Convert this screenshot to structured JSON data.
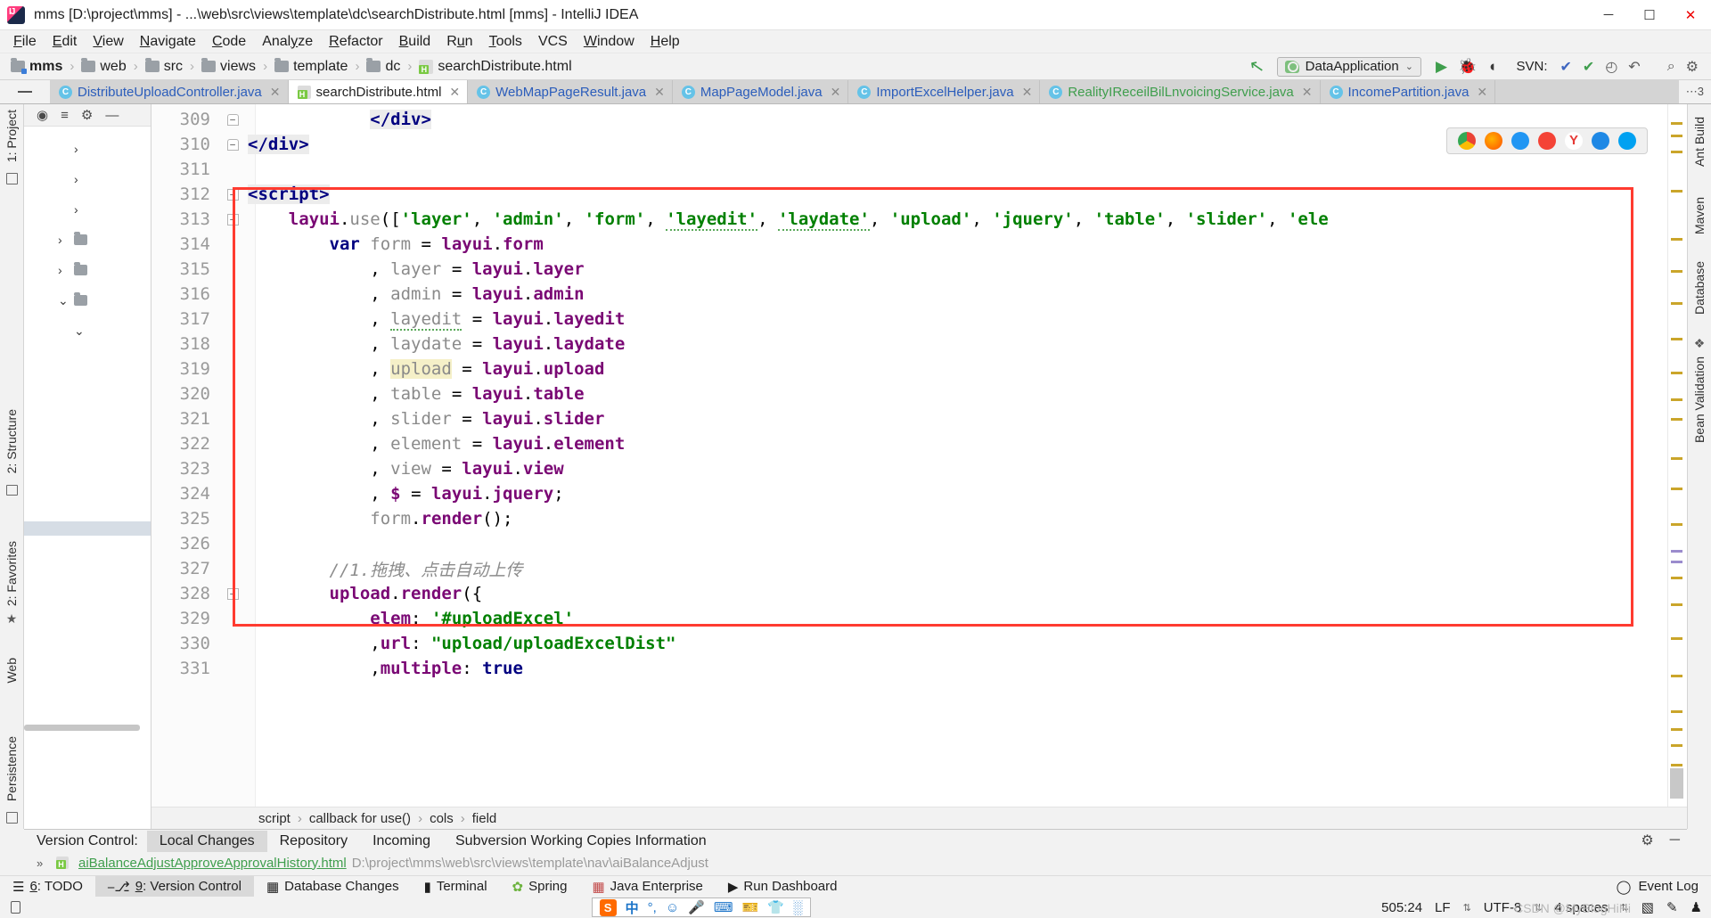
{
  "window": {
    "title": "mms [D:\\project\\mms] - ...\\web\\src\\views\\template\\dc\\searchDistribute.html [mms] - IntelliJ IDEA",
    "minimize": "─",
    "maximize": "☐",
    "close": "✕"
  },
  "menubar": [
    {
      "label": "File"
    },
    {
      "label": "Edit"
    },
    {
      "label": "View"
    },
    {
      "label": "Navigate"
    },
    {
      "label": "Code"
    },
    {
      "label": "Analyze"
    },
    {
      "label": "Refactor"
    },
    {
      "label": "Build"
    },
    {
      "label": "Run"
    },
    {
      "label": "Tools"
    },
    {
      "label": "VCS"
    },
    {
      "label": "Window"
    },
    {
      "label": "Help"
    }
  ],
  "breadcrumb": {
    "items": [
      "mms",
      "web",
      "src",
      "views",
      "template",
      "dc"
    ],
    "file": "searchDistribute.html",
    "separator": "›"
  },
  "run_toolbar": {
    "back_arrow": "↖",
    "config_name": "DataApplication",
    "dropdown_caret": "⌄",
    "run_icon": "▶",
    "debug_icon": "🐞",
    "coverage_icon": "◖",
    "svn_label": "SVN:",
    "svn_update": "✔",
    "svn_commit": "✔",
    "history_icon": "◴",
    "rollback_icon": "↶",
    "search_icon": "⌕",
    "settings_icon": "⚙"
  },
  "tabs": [
    {
      "label": "DistributeUploadController.java",
      "icon": "class-icon",
      "active": false,
      "color": "blue"
    },
    {
      "label": "searchDistribute.html",
      "icon": "html-icon",
      "active": true,
      "color": "black"
    },
    {
      "label": "WebMapPageResult.java",
      "icon": "class-icon",
      "active": false,
      "color": "blue"
    },
    {
      "label": "MapPageModel.java",
      "icon": "class-icon",
      "active": false,
      "color": "blue"
    },
    {
      "label": "ImportExcelHelper.java",
      "icon": "class-icon",
      "active": false,
      "color": "blue"
    },
    {
      "label": "RealityIReceilBilLnvoicingService.java",
      "icon": "class-icon",
      "active": false,
      "color": "green"
    },
    {
      "label": "IncomePartition.java",
      "icon": "class-icon",
      "active": false,
      "color": "blue"
    }
  ],
  "tab_overflow": "⋯3",
  "tab_close_glyph": "✕",
  "left_toolwindows": [
    {
      "label": "1: Project",
      "selected": false
    },
    {
      "label": "2: Structure",
      "selected": false
    },
    {
      "label": "2: Favorites",
      "selected": false
    },
    {
      "label": "Web",
      "selected": false
    },
    {
      "label": "Persistence",
      "selected": false
    }
  ],
  "right_toolwindows": [
    {
      "label": "Ant Build"
    },
    {
      "label": "Maven"
    },
    {
      "label": "Database"
    },
    {
      "label": "Bean Validation"
    }
  ],
  "editor": {
    "lines": [
      {
        "n": "309",
        "fold": "house",
        "indent": 6,
        "tokens": [
          {
            "t": "</div>",
            "c": "tag hl"
          }
        ]
      },
      {
        "n": "310",
        "fold": "house",
        "indent": 0,
        "tokens": [
          {
            "t": "</div>",
            "c": "tag hl"
          }
        ]
      },
      {
        "n": "311",
        "fold": "",
        "indent": 0,
        "tokens": []
      },
      {
        "n": "312",
        "fold": "down",
        "indent": 0,
        "tokens": [
          {
            "t": "<script>",
            "c": "tag hl"
          }
        ]
      },
      {
        "n": "313",
        "fold": "down",
        "indent": 2,
        "tokens": [
          {
            "t": "layui",
            "c": "fn"
          },
          {
            "t": ".",
            "c": "plain"
          },
          {
            "t": "use",
            "c": "ident"
          },
          {
            "t": "([",
            "c": "plain"
          },
          {
            "t": "'layer'",
            "c": "str"
          },
          {
            "t": ", ",
            "c": "plain"
          },
          {
            "t": "'admin'",
            "c": "str"
          },
          {
            "t": ", ",
            "c": "plain"
          },
          {
            "t": "'form'",
            "c": "str"
          },
          {
            "t": ", ",
            "c": "plain"
          },
          {
            "t": "'layedit'",
            "c": "str wavy"
          },
          {
            "t": ", ",
            "c": "plain"
          },
          {
            "t": "'laydate'",
            "c": "str wavy"
          },
          {
            "t": ", ",
            "c": "plain"
          },
          {
            "t": "'upload'",
            "c": "str"
          },
          {
            "t": ", ",
            "c": "plain"
          },
          {
            "t": "'jquery'",
            "c": "str"
          },
          {
            "t": ", ",
            "c": "plain"
          },
          {
            "t": "'table'",
            "c": "str"
          },
          {
            "t": ", ",
            "c": "plain"
          },
          {
            "t": "'slider'",
            "c": "str"
          },
          {
            "t": ", ",
            "c": "plain"
          },
          {
            "t": "'ele",
            "c": "str"
          }
        ]
      },
      {
        "n": "314",
        "fold": "",
        "indent": 4,
        "tokens": [
          {
            "t": "var",
            "c": "kw"
          },
          {
            "t": " ",
            "c": "plain"
          },
          {
            "t": "form",
            "c": "ident"
          },
          {
            "t": " = ",
            "c": "plain"
          },
          {
            "t": "layui",
            "c": "fn"
          },
          {
            "t": ".",
            "c": "plain"
          },
          {
            "t": "form",
            "c": "fn"
          }
        ]
      },
      {
        "n": "315",
        "fold": "",
        "indent": 6,
        "tokens": [
          {
            "t": ", ",
            "c": "plain"
          },
          {
            "t": "layer",
            "c": "ident"
          },
          {
            "t": " = ",
            "c": "plain"
          },
          {
            "t": "layui",
            "c": "fn"
          },
          {
            "t": ".",
            "c": "plain"
          },
          {
            "t": "layer",
            "c": "fn"
          }
        ]
      },
      {
        "n": "316",
        "fold": "",
        "indent": 6,
        "tokens": [
          {
            "t": ", ",
            "c": "plain"
          },
          {
            "t": "admin",
            "c": "ident"
          },
          {
            "t": " = ",
            "c": "plain"
          },
          {
            "t": "layui",
            "c": "fn"
          },
          {
            "t": ".",
            "c": "plain"
          },
          {
            "t": "admin",
            "c": "fn"
          }
        ]
      },
      {
        "n": "317",
        "fold": "",
        "indent": 6,
        "tokens": [
          {
            "t": ", ",
            "c": "plain"
          },
          {
            "t": "layedit",
            "c": "ident wavy"
          },
          {
            "t": " = ",
            "c": "plain"
          },
          {
            "t": "layui",
            "c": "fn"
          },
          {
            "t": ".",
            "c": "plain"
          },
          {
            "t": "layedit",
            "c": "fn"
          }
        ]
      },
      {
        "n": "318",
        "fold": "",
        "indent": 6,
        "tokens": [
          {
            "t": ", ",
            "c": "plain"
          },
          {
            "t": "laydate",
            "c": "ident"
          },
          {
            "t": " = ",
            "c": "plain"
          },
          {
            "t": "layui",
            "c": "fn"
          },
          {
            "t": ".",
            "c": "plain"
          },
          {
            "t": "laydate",
            "c": "fn"
          }
        ]
      },
      {
        "n": "319",
        "fold": "",
        "indent": 6,
        "tokens": [
          {
            "t": ", ",
            "c": "plain"
          },
          {
            "t": "upload",
            "c": "ident hlsoft"
          },
          {
            "t": " = ",
            "c": "plain"
          },
          {
            "t": "layui",
            "c": "fn"
          },
          {
            "t": ".",
            "c": "plain"
          },
          {
            "t": "upload",
            "c": "fn"
          }
        ]
      },
      {
        "n": "320",
        "fold": "",
        "indent": 6,
        "tokens": [
          {
            "t": ", ",
            "c": "plain"
          },
          {
            "t": "table",
            "c": "ident"
          },
          {
            "t": " = ",
            "c": "plain"
          },
          {
            "t": "layui",
            "c": "fn"
          },
          {
            "t": ".",
            "c": "plain"
          },
          {
            "t": "table",
            "c": "fn"
          }
        ]
      },
      {
        "n": "321",
        "fold": "",
        "indent": 6,
        "tokens": [
          {
            "t": ", ",
            "c": "plain"
          },
          {
            "t": "slider",
            "c": "ident"
          },
          {
            "t": " = ",
            "c": "plain"
          },
          {
            "t": "layui",
            "c": "fn"
          },
          {
            "t": ".",
            "c": "plain"
          },
          {
            "t": "slider",
            "c": "fn"
          }
        ]
      },
      {
        "n": "322",
        "fold": "",
        "indent": 6,
        "tokens": [
          {
            "t": ", ",
            "c": "plain"
          },
          {
            "t": "element",
            "c": "ident"
          },
          {
            "t": " = ",
            "c": "plain"
          },
          {
            "t": "layui",
            "c": "fn"
          },
          {
            "t": ".",
            "c": "plain"
          },
          {
            "t": "element",
            "c": "fn"
          }
        ]
      },
      {
        "n": "323",
        "fold": "",
        "indent": 6,
        "tokens": [
          {
            "t": ", ",
            "c": "plain"
          },
          {
            "t": "view",
            "c": "ident"
          },
          {
            "t": " = ",
            "c": "plain"
          },
          {
            "t": "layui",
            "c": "fn"
          },
          {
            "t": ".",
            "c": "plain"
          },
          {
            "t": "view",
            "c": "fn"
          }
        ]
      },
      {
        "n": "324",
        "fold": "",
        "indent": 6,
        "tokens": [
          {
            "t": ", ",
            "c": "plain"
          },
          {
            "t": "$",
            "c": "fn"
          },
          {
            "t": " = ",
            "c": "plain"
          },
          {
            "t": "layui",
            "c": "fn"
          },
          {
            "t": ".",
            "c": "plain"
          },
          {
            "t": "jquery",
            "c": "fn"
          },
          {
            "t": ";",
            "c": "plain"
          }
        ]
      },
      {
        "n": "325",
        "fold": "",
        "indent": 6,
        "tokens": [
          {
            "t": "form",
            "c": "ident"
          },
          {
            "t": ".",
            "c": "plain"
          },
          {
            "t": "render",
            "c": "fn"
          },
          {
            "t": "();",
            "c": "plain"
          }
        ]
      },
      {
        "n": "326",
        "fold": "",
        "indent": 0,
        "tokens": []
      },
      {
        "n": "327",
        "fold": "",
        "indent": 4,
        "tokens": [
          {
            "t": "//1.拖拽、点击自动上传",
            "c": "cmt"
          }
        ]
      },
      {
        "n": "328",
        "fold": "down",
        "indent": 4,
        "tokens": [
          {
            "t": "upload",
            "c": "fn"
          },
          {
            "t": ".",
            "c": "plain"
          },
          {
            "t": "render",
            "c": "fn"
          },
          {
            "t": "({",
            "c": "plain"
          }
        ]
      },
      {
        "n": "329",
        "fold": "",
        "indent": 6,
        "tokens": [
          {
            "t": "elem",
            "c": "fn"
          },
          {
            "t": ": ",
            "c": "plain"
          },
          {
            "t": "'#uploadExcel'",
            "c": "str"
          }
        ]
      },
      {
        "n": "330",
        "fold": "",
        "indent": 6,
        "tokens": [
          {
            "t": ",",
            "c": "plain"
          },
          {
            "t": "url",
            "c": "fn"
          },
          {
            "t": ": ",
            "c": "plain"
          },
          {
            "t": "\"upload/uploadExcelDist\"",
            "c": "str"
          }
        ]
      },
      {
        "n": "331",
        "fold": "",
        "indent": 6,
        "tokens": [
          {
            "t": ",",
            "c": "plain"
          },
          {
            "t": "multiple",
            "c": "fn"
          },
          {
            "t": ": ",
            "c": "plain"
          },
          {
            "t": "true",
            "c": "kw"
          }
        ]
      }
    ]
  },
  "browser_popup": {
    "icons": [
      "chrome-icon",
      "firefox-icon",
      "safari-icon",
      "opera-icon",
      "yandex-icon",
      "ie-icon",
      "edge-icon"
    ],
    "colors": [
      "#4caf50",
      "#ff9800",
      "#2196f3",
      "#f44336",
      "#e53935",
      "#1e88e5",
      "#00a1f1"
    ]
  },
  "editor_breadcrumb": {
    "items": [
      "script",
      "callback for use()",
      "cols",
      "field"
    ],
    "separator": "›"
  },
  "version_control": {
    "label": "Version Control:",
    "tabs": [
      {
        "label": "Local Changes",
        "selected": true
      },
      {
        "label": "Repository",
        "selected": false
      },
      {
        "label": "Incoming",
        "selected": false
      },
      {
        "label": "Subversion Working Copies Information",
        "selected": false
      }
    ],
    "row": {
      "expander": "»",
      "file": "aiBalanceAdjustApproveApprovalHistory.html",
      "path": "D:\\project\\mms\\web\\src\\views\\template\\nav\\aiBalanceAdjust"
    },
    "settings_icon": "⚙",
    "minimize_icon": "─"
  },
  "tool_windows_bottom": [
    {
      "label": "6: TODO",
      "icon": "todo-icon",
      "selected": false
    },
    {
      "label": "9: Version Control",
      "icon": "branch-icon",
      "selected": true
    },
    {
      "label": "Database Changes",
      "icon": "database-icon",
      "selected": false
    },
    {
      "label": "Terminal",
      "icon": "terminal-icon",
      "selected": false
    },
    {
      "label": "Spring",
      "icon": "spring-icon",
      "selected": false
    },
    {
      "label": "Java Enterprise",
      "icon": "java-ee-icon",
      "selected": false
    },
    {
      "label": "Run Dashboard",
      "icon": "play-icon",
      "selected": false
    }
  ],
  "event_log": {
    "label": "Event Log",
    "icon": "balloon-icon"
  },
  "statusbar": {
    "ime": {
      "logo": "S",
      "items": [
        "中",
        "°,",
        "☺",
        "🎤",
        "⌨",
        "🎫",
        "👕",
        "░"
      ]
    },
    "caret_position": "505:24",
    "line_separator": "LF",
    "encoding": "UTF-8",
    "indent": "4 spaces",
    "watermark": "CSDN @MyBlogHiHi",
    "stepper": "⇅"
  }
}
